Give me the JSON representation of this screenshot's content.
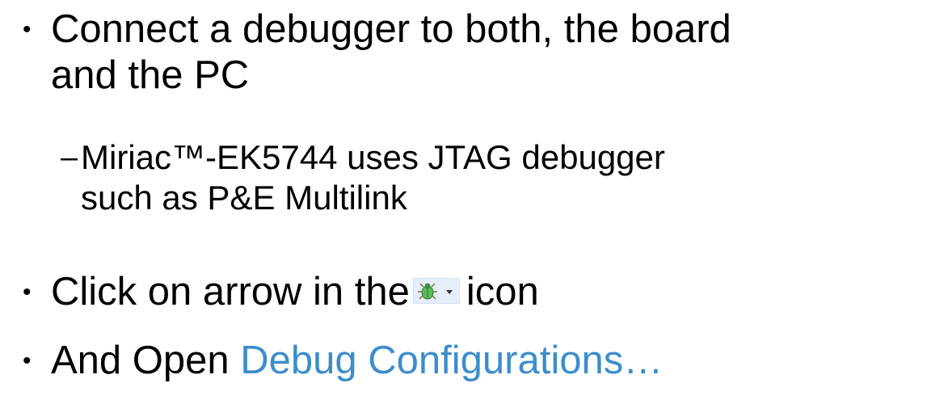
{
  "bullets": [
    {
      "lines": [
        "Connect a debugger to both, the board",
        "and the PC"
      ]
    },
    {
      "dash": "–",
      "lines": [
        "Miriac™-EK5744 uses JTAG debugger",
        "such as P&E Multilink"
      ]
    },
    {
      "before_icon": "Click on arrow in the",
      "icon": "debug-bug-dropdown-icon",
      "after_icon": "icon"
    },
    {
      "before_link": "And Open ",
      "link": "Debug Configurations…"
    }
  ],
  "bullet_char": "•",
  "colors": {
    "text": "#000000",
    "link": "#3c8dcb",
    "icon_bg": "#e6eefb",
    "bug_green": "#4caf50"
  }
}
